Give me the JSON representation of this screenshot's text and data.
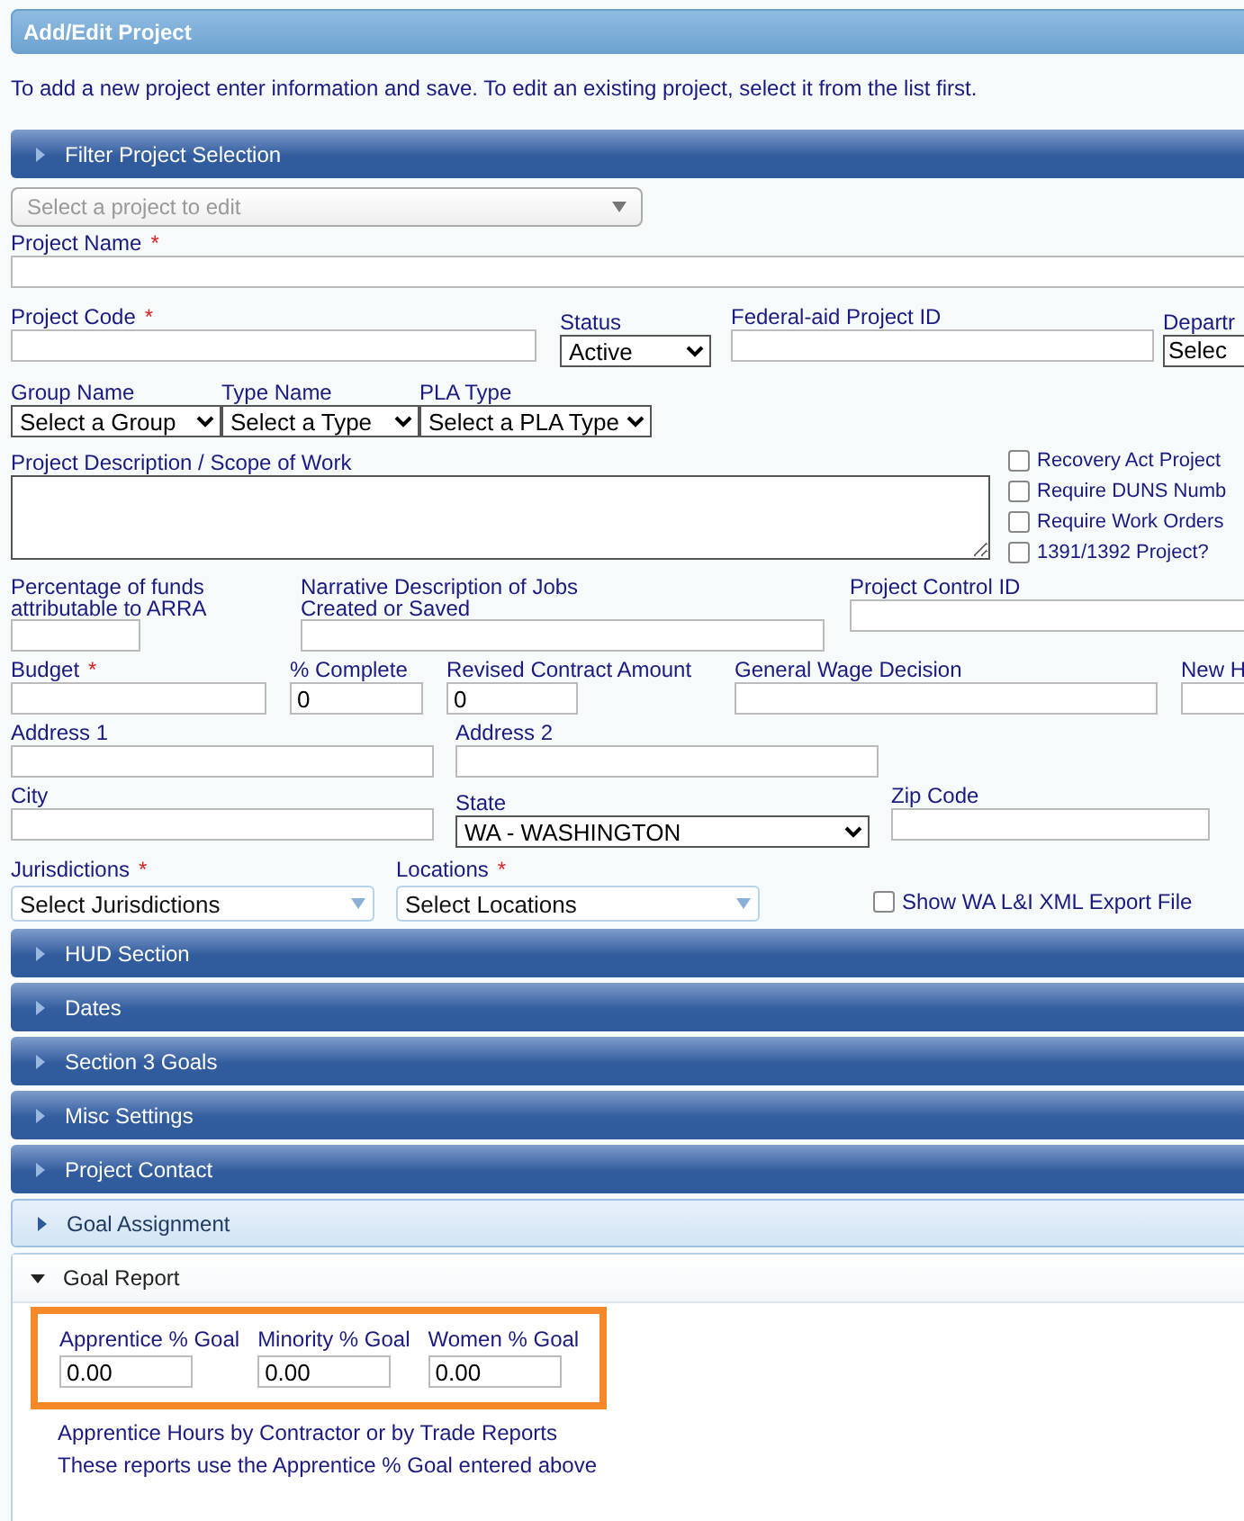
{
  "header": {
    "title": "Add/Edit Project"
  },
  "intro": "To add a new project enter information and save. To edit an existing project, select it from the list first.",
  "filter_panel": {
    "title": "Filter Project Selection",
    "expanded": false
  },
  "project_select": {
    "placeholder": "Select a project to edit",
    "disabled": true
  },
  "project_name": {
    "label": "Project Name",
    "required_mark": "*"
  },
  "project_code": {
    "label": "Project Code",
    "required_mark": "*"
  },
  "status": {
    "label": "Status",
    "value": "Active"
  },
  "federal_aid_id": {
    "label": "Federal-aid Project ID"
  },
  "department": {
    "label": "Departr",
    "value": "Selec"
  },
  "group_name": {
    "label": "Group Name",
    "value": "Select a Group"
  },
  "type_name": {
    "label": "Type Name",
    "value": "Select a Type"
  },
  "pla_type": {
    "label": "PLA Type",
    "value": "Select a PLA Type"
  },
  "description": {
    "label": "Project Description / Scope of Work"
  },
  "options": [
    {
      "label": "Recovery Act Project",
      "checked": false
    },
    {
      "label": "Require DUNS Numb",
      "checked": false
    },
    {
      "label": "Require Work Orders",
      "checked": false
    },
    {
      "label": "1391/1392 Project?",
      "checked": false
    }
  ],
  "arra_percentage": {
    "label": "Percentage of funds attributable to ARRA"
  },
  "narrative": {
    "label": "Narrative Description of Jobs Created or Saved"
  },
  "control_id": {
    "label": "Project Control ID"
  },
  "budget": {
    "label": "Budget",
    "required_mark": "*"
  },
  "percent_complete": {
    "label": "% Complete",
    "value": "0"
  },
  "revised_amount": {
    "label": "Revised Contract Amount",
    "value": "0"
  },
  "wage_decision": {
    "label": "General Wage Decision"
  },
  "new_h": {
    "label": "New H"
  },
  "address1": {
    "label": "Address 1"
  },
  "address2": {
    "label": "Address 2"
  },
  "city": {
    "label": "City"
  },
  "state": {
    "label": "State",
    "value": "WA - WASHINGTON"
  },
  "zip": {
    "label": "Zip Code"
  },
  "jurisdictions": {
    "label": "Jurisdictions",
    "required_mark": "*",
    "value": "Select Jurisdictions"
  },
  "locations": {
    "label": "Locations",
    "required_mark": "*",
    "value": "Select Locations"
  },
  "export_option": {
    "label": "Show WA L&I XML Export File",
    "checked": false
  },
  "sections": [
    {
      "title": "HUD Section",
      "expanded": false,
      "highlighted": false
    },
    {
      "title": "Dates",
      "expanded": false,
      "highlighted": false
    },
    {
      "title": "Section 3 Goals",
      "expanded": false,
      "highlighted": false
    },
    {
      "title": "Misc Settings",
      "expanded": false,
      "highlighted": false
    },
    {
      "title": "Project Contact",
      "expanded": false,
      "highlighted": false
    },
    {
      "title": "Goal Assignment",
      "expanded": false,
      "highlighted": true
    }
  ],
  "goal_report": {
    "title": "Goal Report",
    "expanded": true,
    "goals": [
      {
        "label": "Apprentice % Goal",
        "value": "0.00"
      },
      {
        "label": "Minority % Goal",
        "value": "0.00"
      },
      {
        "label": "Women % Goal",
        "value": "0.00"
      }
    ],
    "notes": [
      "Apprentice Hours by Contractor or by Trade Reports",
      "These reports use the Apprentice % Goal entered above"
    ]
  }
}
